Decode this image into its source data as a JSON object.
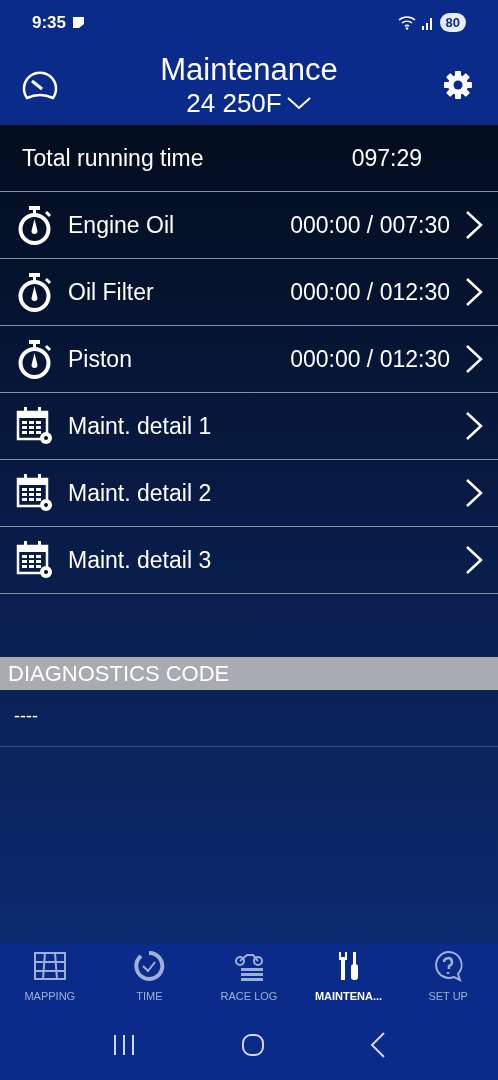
{
  "status_bar": {
    "time": "9:35",
    "battery": "80"
  },
  "header": {
    "title": "Maintenance",
    "model": "24 250F"
  },
  "total": {
    "label": "Total running time",
    "value": "097:29"
  },
  "items": [
    {
      "kind": "timer",
      "label": "Engine Oil",
      "value": "000:00 / 007:30"
    },
    {
      "kind": "timer",
      "label": "Oil Filter",
      "value": "000:00 / 012:30"
    },
    {
      "kind": "timer",
      "label": "Piston",
      "value": "000:00 / 012:30"
    },
    {
      "kind": "calendar",
      "label": "Maint. detail 1"
    },
    {
      "kind": "calendar",
      "label": "Maint. detail 2"
    },
    {
      "kind": "calendar",
      "label": "Maint. detail 3"
    }
  ],
  "diagnostics": {
    "title": "DIAGNOSTICS CODE",
    "codes": [
      "----"
    ]
  },
  "tabs": [
    {
      "kind": "mapping",
      "label": "MAPPING",
      "selected": false
    },
    {
      "kind": "time",
      "label": "TIME",
      "selected": false
    },
    {
      "kind": "racelog",
      "label": "RACE LOG",
      "selected": false
    },
    {
      "kind": "maintenance",
      "label": "MAINTENA...",
      "selected": true
    },
    {
      "kind": "setup",
      "label": "SET UP",
      "selected": false
    }
  ]
}
